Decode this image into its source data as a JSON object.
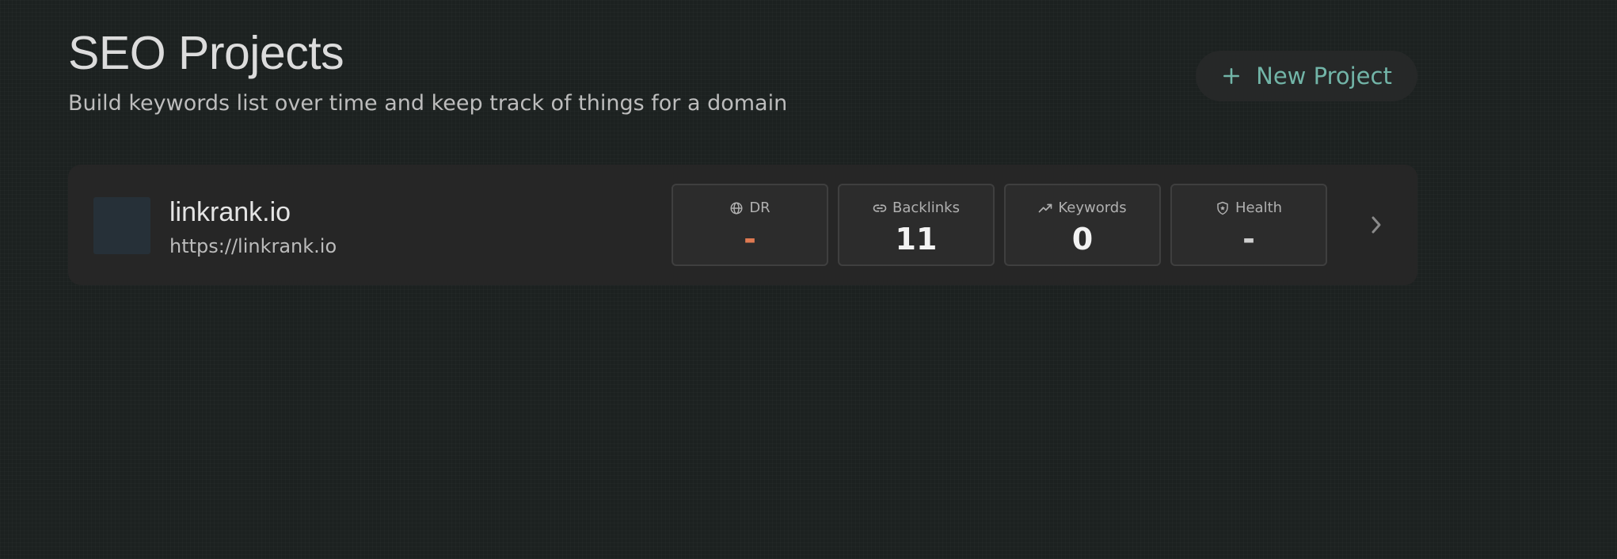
{
  "header": {
    "title": "SEO Projects",
    "subtitle": "Build keywords list over time and keep track of things for a domain"
  },
  "actions": {
    "new_project_label": "New Project",
    "new_project_icon": "plus-icon"
  },
  "projects": [
    {
      "name": "linkrank.io",
      "url": "https://linkrank.io",
      "stats": [
        {
          "label": "DR",
          "value": "-",
          "icon": "globe-icon",
          "color": "#e07a52"
        },
        {
          "label": "Backlinks",
          "value": "11",
          "icon": "link-icon"
        },
        {
          "label": "Keywords",
          "value": "0",
          "icon": "trending-up-icon"
        },
        {
          "label": "Health",
          "value": "-",
          "icon": "shield-icon"
        }
      ]
    }
  ],
  "colors": {
    "background": "#1c2120",
    "card": "#262626",
    "accent": "#72b5a8",
    "dr_value": "#e07a52"
  }
}
